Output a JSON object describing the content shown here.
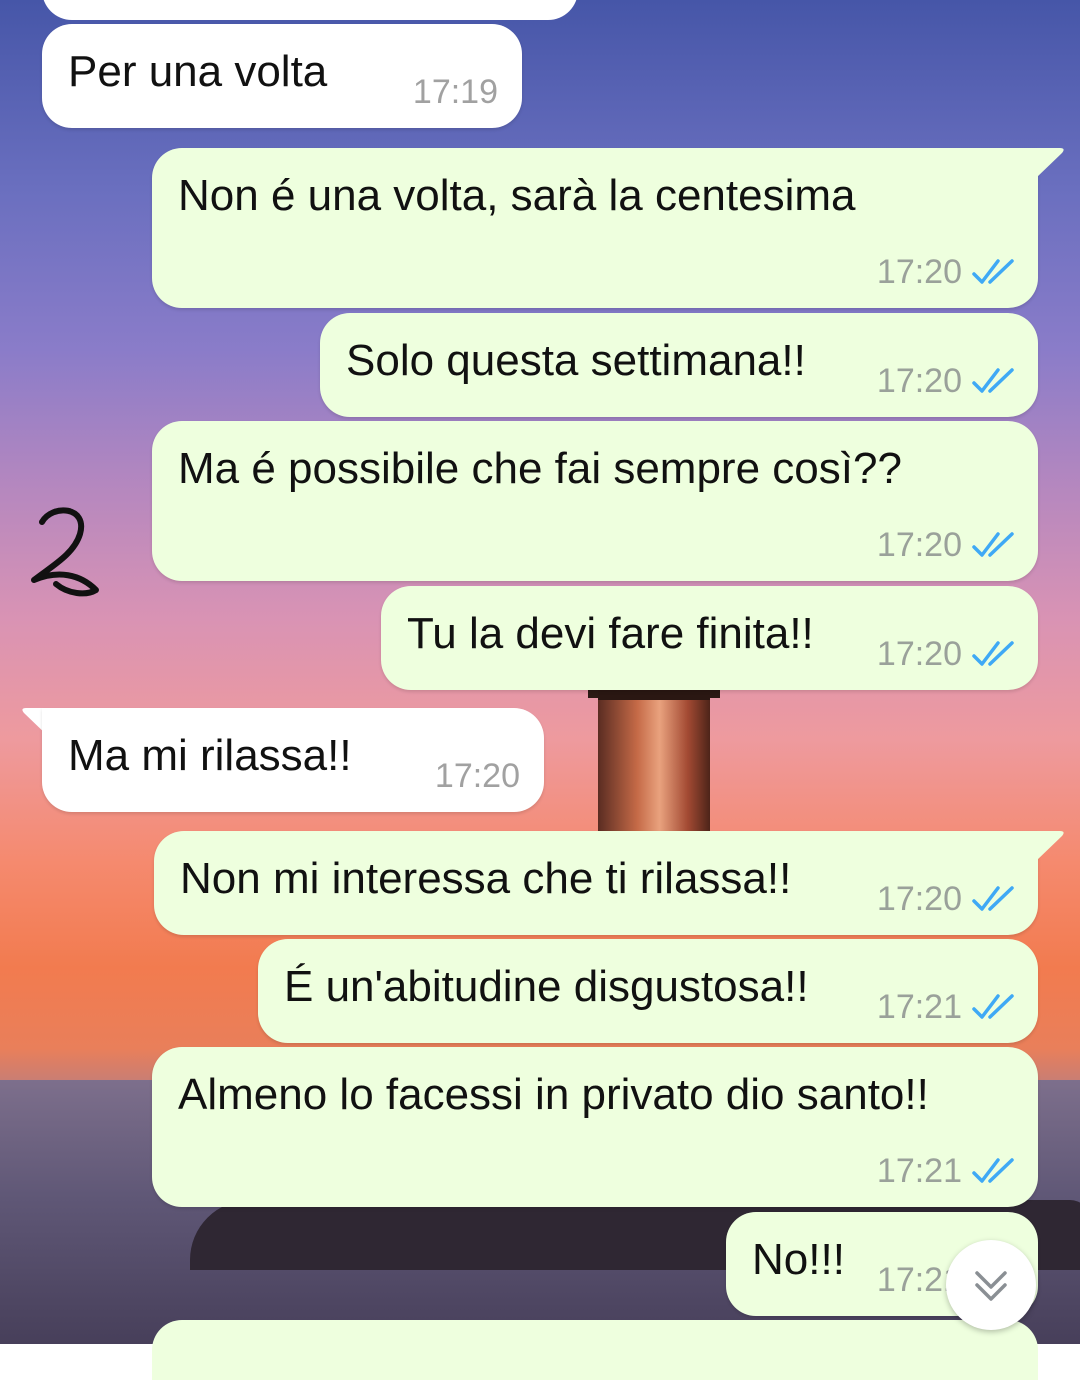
{
  "messages": [
    {
      "id": "m1",
      "dir": "in",
      "text": "Per una volta",
      "time": "17:19"
    },
    {
      "id": "m2",
      "dir": "out",
      "text": "Non é una volta, sarà la centesima",
      "time": "17:20",
      "status": "read"
    },
    {
      "id": "m3",
      "dir": "out",
      "text": "Solo questa settimana!!",
      "time": "17:20",
      "status": "read"
    },
    {
      "id": "m4",
      "dir": "out",
      "text": "Ma é possibile che fai sempre così??",
      "time": "17:20",
      "status": "read"
    },
    {
      "id": "m5",
      "dir": "out",
      "text": "Tu la devi fare finita!!",
      "time": "17:20",
      "status": "read"
    },
    {
      "id": "m6",
      "dir": "in",
      "text": "Ma mi rilassa!!",
      "time": "17:20"
    },
    {
      "id": "m7",
      "dir": "out",
      "text": "Non mi interessa che ti rilassa!!",
      "time": "17:20",
      "status": "read"
    },
    {
      "id": "m8",
      "dir": "out",
      "text": "É un'abitudine disgustosa!!",
      "time": "17:21",
      "status": "read"
    },
    {
      "id": "m9",
      "dir": "out",
      "text": "Almeno lo facessi in privato dio santo!!",
      "time": "17:21",
      "status": "read"
    },
    {
      "id": "m10",
      "dir": "out",
      "text": "No!!!",
      "time": "17:21",
      "status": "read"
    }
  ],
  "annotation": "2",
  "scroll_button_icon": "double-chevron-down-icon",
  "colors": {
    "outgoing_bubble": "#eeffde",
    "incoming_bubble": "#ffffff",
    "read_ticks": "#3fa9f5"
  }
}
